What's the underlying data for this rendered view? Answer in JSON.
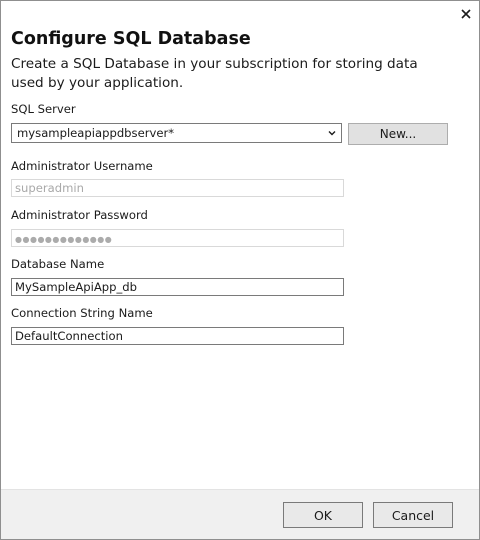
{
  "dialog": {
    "close_glyph": "✕",
    "title": "Configure SQL Database",
    "subtitle": "Create a SQL Database in your subscription for storing data used by your application."
  },
  "form": {
    "sql_server": {
      "label": "SQL Server",
      "selected": "mysampleapiappdbserver*",
      "new_button_label": "New..."
    },
    "admin_username": {
      "label": "Administrator Username",
      "value": "superadmin",
      "disabled": true
    },
    "admin_password": {
      "label": "Administrator Password",
      "masked_value": "●●●●●●●●●●●●●",
      "disabled": true
    },
    "database_name": {
      "label": "Database Name",
      "value": "MySampleApiApp_db"
    },
    "connection_string_name": {
      "label": "Connection String Name",
      "value": "DefaultConnection"
    }
  },
  "footer": {
    "ok_label": "OK",
    "cancel_label": "Cancel"
  },
  "colors": {
    "footer_background": "#f0f0f0",
    "button_background": "#e1e1e1",
    "input_border": "#7a7a7a",
    "disabled_text": "#a9a9a9"
  },
  "icons": {
    "close": "close-icon",
    "dropdown": "chevron-down-icon"
  }
}
